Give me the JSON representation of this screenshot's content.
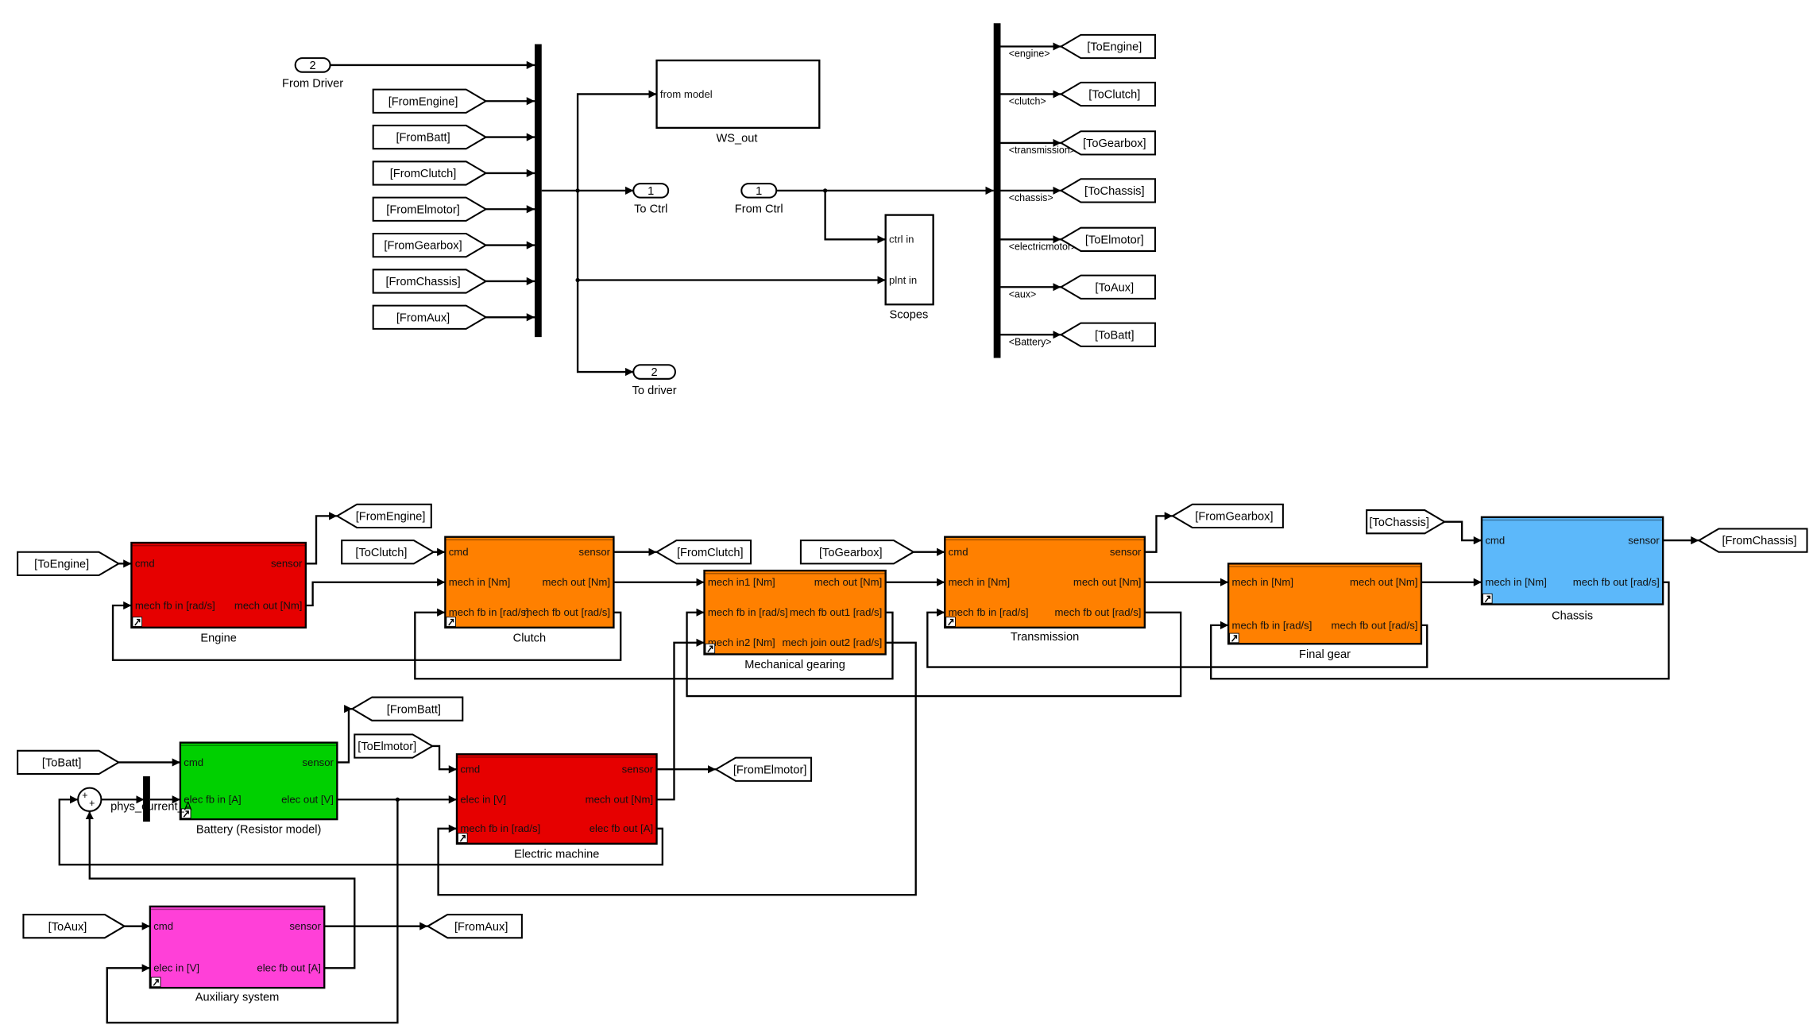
{
  "top": {
    "from_driver": {
      "number": "2",
      "label": "From Driver"
    },
    "bus_inputs": [
      "[FromEngine]",
      "[FromBatt]",
      "[FromClutch]",
      "[FromElmotor]",
      "[FromGearbox]",
      "[FromChassis]",
      "[FromAux]"
    ],
    "to_ctrl": {
      "number": "1",
      "label": "To Ctrl"
    },
    "to_driver": {
      "number": "2",
      "label": "To driver"
    },
    "from_ctrl": {
      "number": "1",
      "label": "From Ctrl"
    },
    "ws_out": {
      "label": "WS_out",
      "port": "from model"
    },
    "scopes": {
      "label": "Scopes",
      "ports": [
        "ctrl in",
        "plnt in"
      ]
    },
    "bus_outputs": [
      {
        "signal": "<engine>",
        "tag": "[ToEngine]"
      },
      {
        "signal": "<clutch>",
        "tag": "[ToClutch]"
      },
      {
        "signal": "<transmission>",
        "tag": "[ToGearbox]"
      },
      {
        "signal": "<chassis>",
        "tag": "[ToChassis]"
      },
      {
        "signal": "<electricmotor>",
        "tag": "[ToElmotor]"
      },
      {
        "signal": "<aux>",
        "tag": "[ToAux]"
      },
      {
        "signal": "<Battery>",
        "tag": "[ToBatt]"
      }
    ]
  },
  "subsystems": [
    {
      "id": "engine",
      "label": "Engine",
      "color": "#e60000",
      "in": [
        "cmd",
        "mech fb in [rad/s]"
      ],
      "out": [
        "sensor",
        "mech out [Nm]"
      ]
    },
    {
      "id": "clutch",
      "label": "Clutch",
      "color": "#ff8000",
      "in": [
        "cmd",
        "mech in [Nm]",
        "mech fb in [rad/s]"
      ],
      "out": [
        "sensor",
        "mech out [Nm]",
        "mech fb out [rad/s]"
      ]
    },
    {
      "id": "mech_gearing",
      "label": "Mechanical gearing",
      "color": "#ff8000",
      "in": [
        "mech in1 [Nm]",
        "mech fb in [rad/s]",
        "mech in2 [Nm]"
      ],
      "out": [
        "mech out [Nm]",
        "mech fb out1 [rad/s]",
        "mech join out2 [rad/s]"
      ]
    },
    {
      "id": "transmission",
      "label": "Transmission",
      "color": "#ff8000",
      "in": [
        "cmd",
        "mech in [Nm]",
        "mech fb in [rad/s]"
      ],
      "out": [
        "sensor",
        "mech out [Nm]",
        "mech fb out [rad/s]"
      ]
    },
    {
      "id": "final_gear",
      "label": "Final gear",
      "color": "#ff8000",
      "in": [
        "mech in [Nm]",
        "mech fb in [rad/s]"
      ],
      "out": [
        "mech out [Nm]",
        "mech fb out [rad/s]"
      ]
    },
    {
      "id": "chassis",
      "label": "Chassis",
      "color": "#5cb8fa",
      "in": [
        "cmd",
        "mech in [Nm]"
      ],
      "out": [
        "sensor",
        "mech fb out [rad/s]"
      ]
    },
    {
      "id": "battery",
      "label": "Battery (Resistor model)",
      "color": "#00d000",
      "in": [
        "cmd",
        "elec fb in [A]"
      ],
      "out": [
        "sensor",
        "elec out [V]"
      ]
    },
    {
      "id": "electric_machine",
      "label": "Electric machine",
      "color": "#e60000",
      "in": [
        "cmd",
        "elec in [V]",
        "mech fb in [rad/s]"
      ],
      "out": [
        "sensor",
        "mech out [Nm]",
        "elec fb out [A]"
      ]
    },
    {
      "id": "aux",
      "label": "Auxiliary system",
      "color": "#ff40d8",
      "in": [
        "cmd",
        "elec in [V]"
      ],
      "out": [
        "sensor",
        "elec fb out [A]"
      ]
    }
  ],
  "plant_tags": [
    "[ToEngine]",
    "[FromEngine]",
    "[ToClutch]",
    "[FromClutch]",
    "[ToGearbox]",
    "[FromGearbox]",
    "[ToChassis]",
    "[FromChassis]",
    "[ToBatt]",
    "[FromBatt]",
    "[ToElmotor]",
    "[FromElmotor]",
    "[ToAux]",
    "[FromAux]"
  ],
  "sum": {
    "signs": [
      "+",
      "+"
    ]
  },
  "mux_label": "phys_current_A",
  "shortcut_icon": "link-arrow-icon"
}
